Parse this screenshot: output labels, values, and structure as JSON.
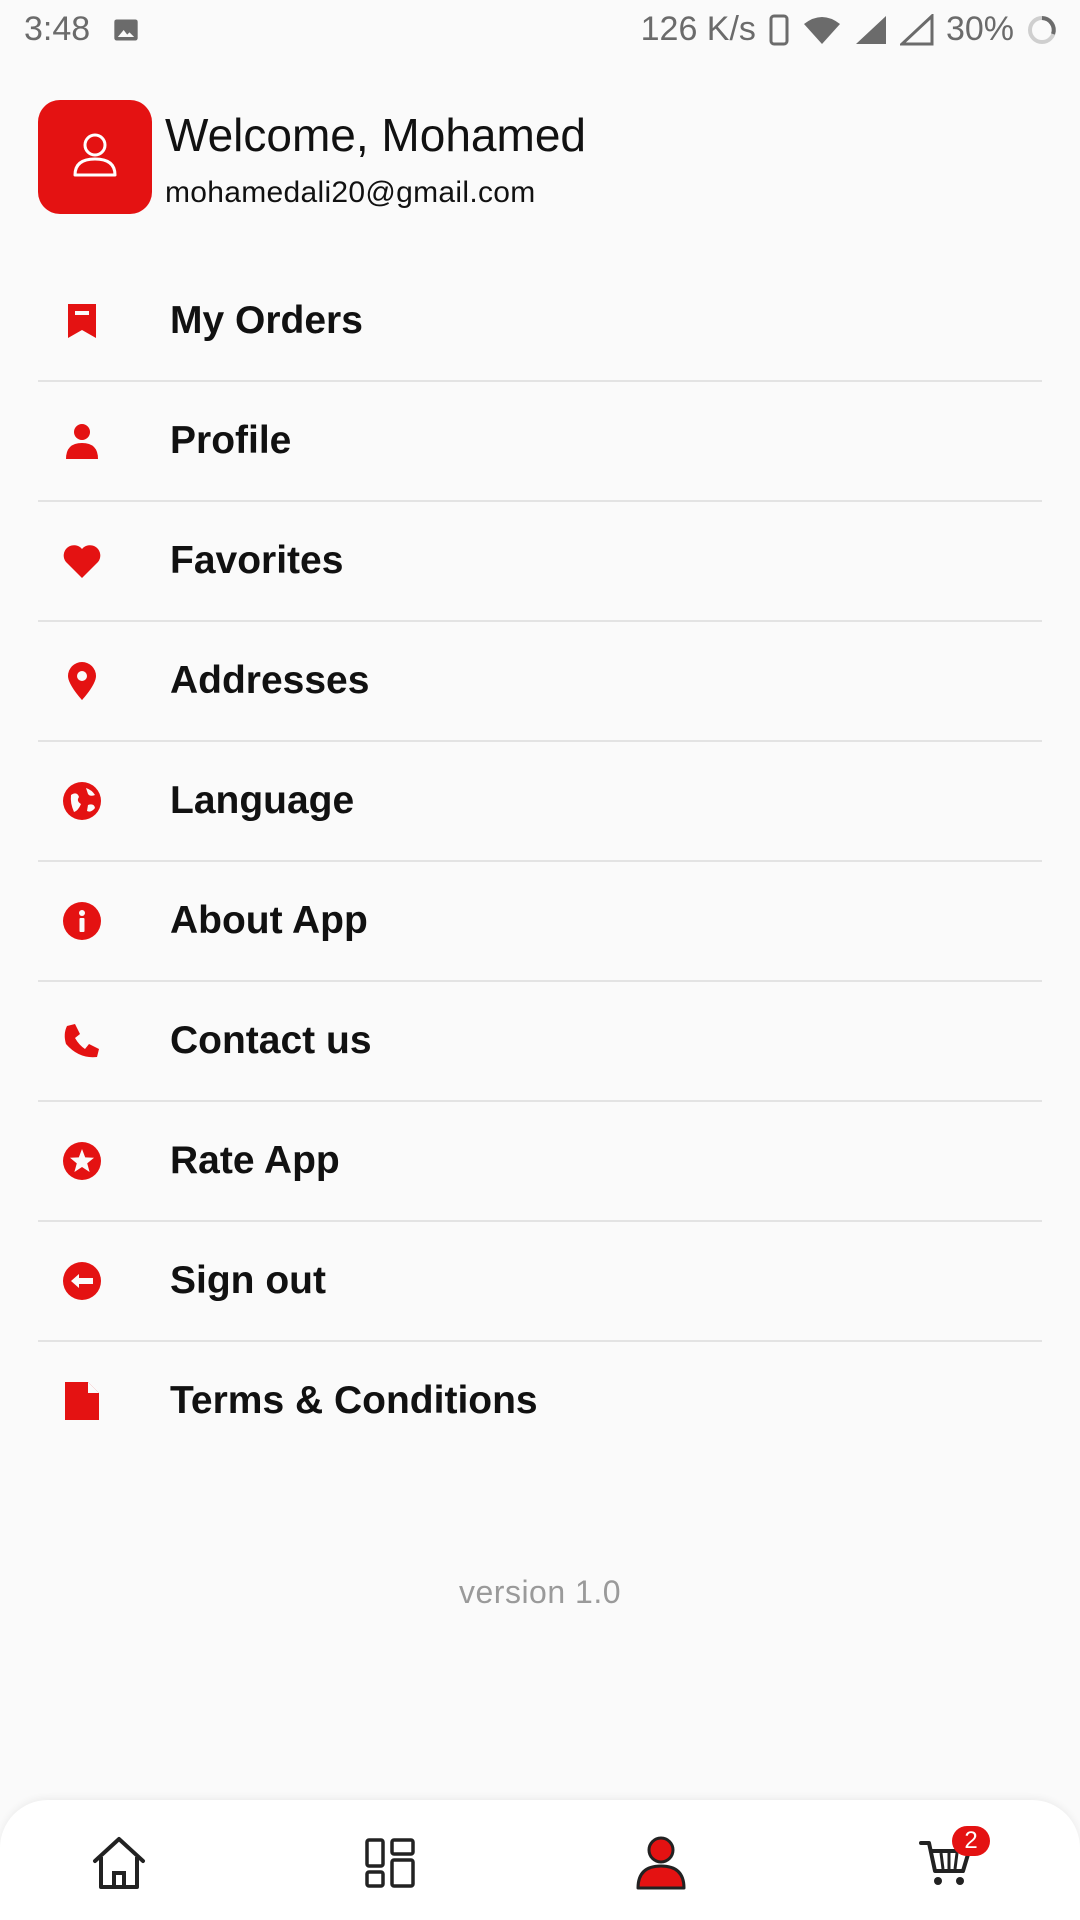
{
  "status_bar": {
    "time": "3:48",
    "network_speed": "126 K/s",
    "battery": "30%",
    "icons": [
      "image-icon",
      "vibrate-icon",
      "wifi-icon",
      "signal-icon",
      "signal-empty-icon",
      "battery-ring-icon"
    ]
  },
  "header": {
    "welcome": "Welcome, Mohamed",
    "email": "mohamedali20@gmail.com",
    "avatar_icon": "user-outline-icon"
  },
  "menu": {
    "items": [
      {
        "label": "My Orders",
        "icon": "orders-bookmark-icon"
      },
      {
        "label": "Profile",
        "icon": "person-icon"
      },
      {
        "label": "Favorites",
        "icon": "heart-icon"
      },
      {
        "label": "Addresses",
        "icon": "location-pin-icon"
      },
      {
        "label": "Language",
        "icon": "globe-icon"
      },
      {
        "label": "About App",
        "icon": "info-icon"
      },
      {
        "label": "Contact us",
        "icon": "phone-icon"
      },
      {
        "label": "Rate App",
        "icon": "star-circle-icon"
      },
      {
        "label": "Sign out",
        "icon": "sign-out-icon"
      },
      {
        "label": "Terms & Conditions",
        "icon": "document-icon"
      }
    ]
  },
  "version": "version 1.0",
  "bottom_nav": {
    "items": [
      "home-icon",
      "categories-icon",
      "account-icon",
      "cart-icon"
    ],
    "active": "account-icon",
    "cart_badge": "2"
  },
  "colors": {
    "accent": "#e41212",
    "text": "#111111",
    "divider": "#e3e3e3",
    "muted": "#9a9a9a",
    "background": "#fafafa"
  }
}
